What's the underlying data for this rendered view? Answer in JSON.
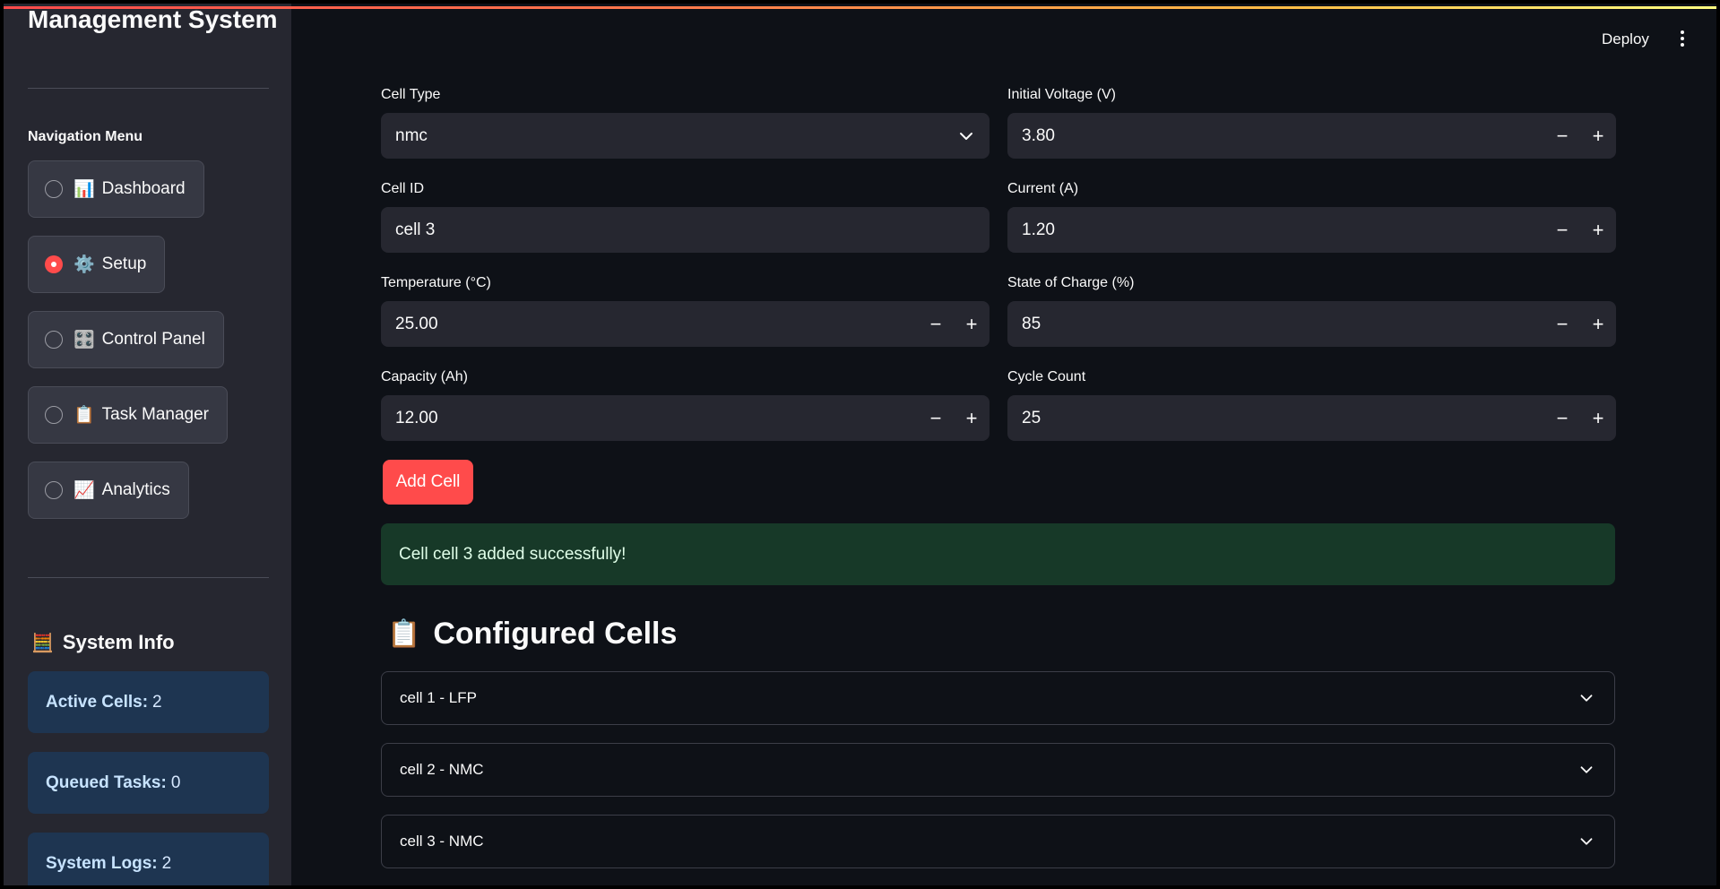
{
  "sidebar": {
    "title": "Management System",
    "nav_label": "Navigation Menu",
    "nav_items": [
      {
        "emoji": "📊",
        "label": "Dashboard",
        "selected": false
      },
      {
        "emoji": "⚙️",
        "label": "Setup",
        "selected": true
      },
      {
        "emoji": "🎛️",
        "label": "Control Panel",
        "selected": false
      },
      {
        "emoji": "📋",
        "label": "Task Manager",
        "selected": false
      },
      {
        "emoji": "📈",
        "label": "Analytics",
        "selected": false
      }
    ],
    "system_info": {
      "emoji": "🧮",
      "title": "System Info",
      "cards": [
        {
          "label": "Active Cells:",
          "value": "2"
        },
        {
          "label": "Queued Tasks:",
          "value": "0"
        },
        {
          "label": "System Logs:",
          "value": "2"
        }
      ]
    }
  },
  "header": {
    "deploy_label": "Deploy"
  },
  "form": {
    "cell_type": {
      "label": "Cell Type",
      "value": "nmc"
    },
    "initial_voltage": {
      "label": "Initial Voltage (V)",
      "value": "3.80"
    },
    "cell_id": {
      "label": "Cell ID",
      "value": "cell 3"
    },
    "current": {
      "label": "Current (A)",
      "value": "1.20"
    },
    "temperature": {
      "label": "Temperature (°C)",
      "value": "25.00"
    },
    "state_of_charge": {
      "label": "State of Charge (%)",
      "value": "85"
    },
    "capacity": {
      "label": "Capacity (Ah)",
      "value": "12.00"
    },
    "cycle_count": {
      "label": "Cycle Count",
      "value": "25"
    },
    "add_button": "Add Cell",
    "stepper_minus": "−",
    "stepper_plus": "+"
  },
  "success_message": "Cell cell 3 added successfully!",
  "configured": {
    "emoji": "📋",
    "title": "Configured Cells",
    "items": [
      "cell 1 - LFP",
      "cell 2 - NMC",
      "cell 3 - NMC"
    ]
  },
  "colors": {
    "accent": "#ff4b4b",
    "background": "#0e1117",
    "sidebar": "#262730",
    "success_bg": "#173928",
    "info_bg": "#1e3551"
  }
}
